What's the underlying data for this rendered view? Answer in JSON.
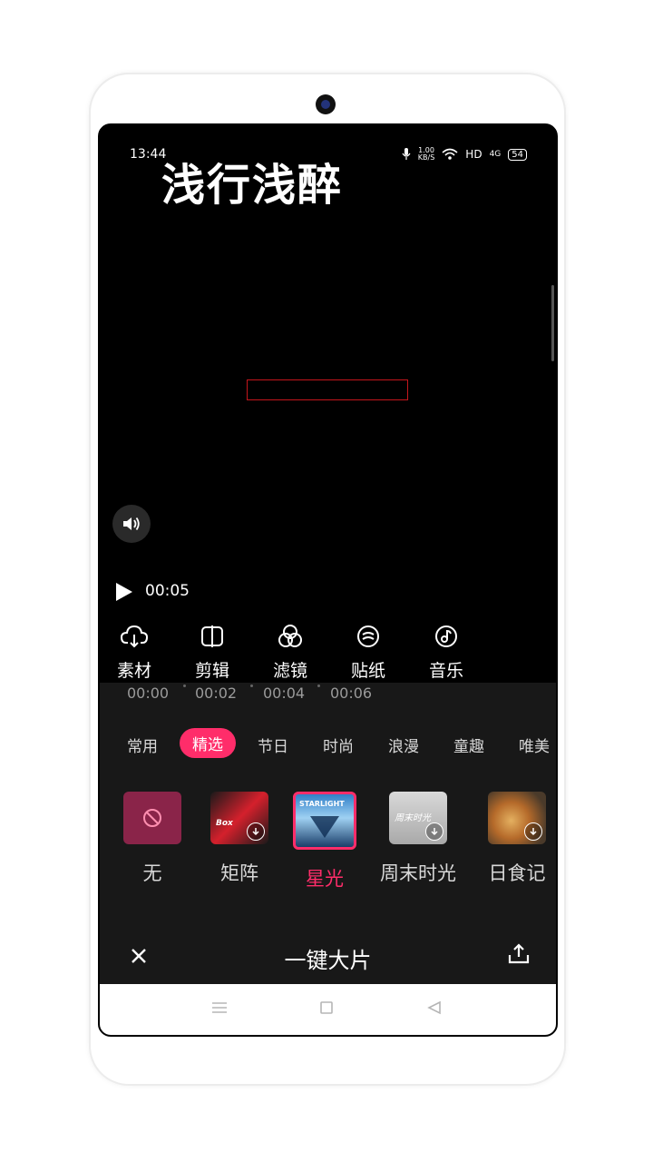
{
  "status": {
    "time": "13:44",
    "speed_value": "1.00",
    "speed_unit": "KB/S",
    "hd": "HD",
    "network": "4G",
    "battery": "54"
  },
  "video": {
    "overlay_title": "浅行浅醉",
    "current_time": "00:05"
  },
  "tools": [
    {
      "label": "素材",
      "icon": "cloud-download-icon"
    },
    {
      "label": "剪辑",
      "icon": "split-icon"
    },
    {
      "label": "滤镜",
      "icon": "filter-icon"
    },
    {
      "label": "贴纸",
      "icon": "sticker-icon"
    },
    {
      "label": "音乐",
      "icon": "music-icon"
    }
  ],
  "timeline": [
    "00:00",
    "00:02",
    "00:04",
    "00:06"
  ],
  "categories": [
    "常用",
    "精选",
    "节日",
    "时尚",
    "浪漫",
    "童趣",
    "唯美"
  ],
  "active_category": "精选",
  "templates": [
    {
      "name": "无"
    },
    {
      "name": "矩阵",
      "thumb_text": "Box"
    },
    {
      "name": "星光",
      "thumb_text": "STARLIGHT"
    },
    {
      "name": "周末时光",
      "thumb_text": "周末时光"
    },
    {
      "name": "日食记"
    }
  ],
  "selected_template": "星光",
  "footer": {
    "title": "一键大片"
  },
  "colors": {
    "accent": "#ff2d6a",
    "panel_bg": "#181818",
    "video_bg": "#000000",
    "video_box_border": "#c4161c"
  }
}
